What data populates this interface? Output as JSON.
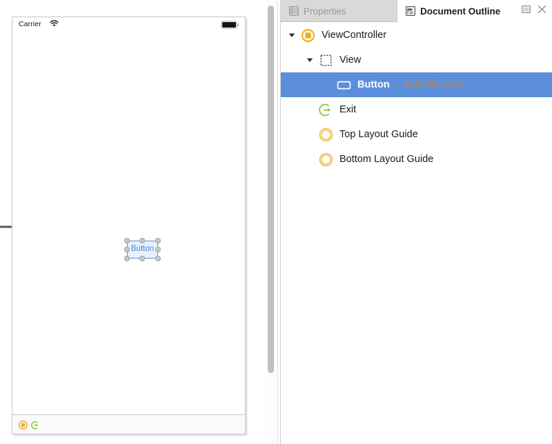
{
  "canvas": {
    "status_bar": {
      "carrier": "Carrier",
      "wifi_icon": "wifi-icon",
      "battery_icon": "battery-icon"
    },
    "entry_arrow_icon": "entry-point-arrow-icon",
    "button_widget": {
      "label": "Button",
      "selected": true,
      "border_color": "#5d8fe8",
      "text_color": "#4a7fe0",
      "handle_count": 8
    },
    "dock": {
      "view_controller_icon": "view-controller-icon",
      "exit_icon": "exit-icon"
    }
  },
  "inspector": {
    "tabs": [
      {
        "label": "Properties",
        "icon": "properties-list-icon",
        "active": false
      },
      {
        "label": "Document Outline",
        "icon": "document-outline-icon",
        "active": true
      }
    ],
    "window_buttons": [
      {
        "name": "maximize",
        "glyph": "□"
      },
      {
        "name": "close",
        "glyph": "✕"
      }
    ],
    "tree": [
      {
        "label": "ViewController",
        "annotation": "",
        "icon": "view-controller-icon",
        "twisty": "expanded",
        "indent": 0,
        "selected": false
      },
      {
        "label": "View",
        "annotation": "",
        "icon": "view-dashed-square-icon",
        "twisty": "expanded",
        "indent": 1,
        "selected": false
      },
      {
        "label": "Button",
        "annotation": "– SubmitButton",
        "icon": "button-rect-icon",
        "twisty": "none",
        "indent": 2,
        "selected": true
      },
      {
        "label": "Exit",
        "annotation": "",
        "icon": "exit-icon",
        "twisty": "none",
        "indent": 1,
        "selected": false
      },
      {
        "label": "Top Layout Guide",
        "annotation": "",
        "icon": "layout-guide-icon",
        "twisty": "none",
        "indent": 1,
        "selected": false
      },
      {
        "label": "Bottom Layout Guide",
        "annotation": "",
        "icon": "layout-guide-icon",
        "twisty": "none",
        "indent": 1,
        "selected": false
      }
    ]
  },
  "colors": {
    "selection_blue": "#5b8edd",
    "annotation_brown": "#b08a55",
    "icon_yellow": "#eeb11e",
    "icon_green": "#84c34a",
    "tab_inactive_bg": "#d9d9d9"
  }
}
